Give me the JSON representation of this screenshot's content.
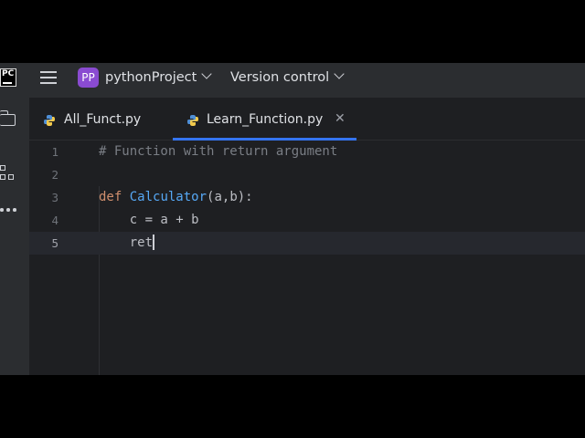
{
  "titlebar": {
    "app_logo": "PC",
    "project_badge": "PP",
    "project_name": "pythonProject",
    "version_control": "Version control"
  },
  "tabs": [
    {
      "label": "All_Funct.py",
      "active": false
    },
    {
      "label": "Learn_Function.py",
      "active": true,
      "close": "✕"
    }
  ],
  "editor": {
    "current_line": 5,
    "lines": [
      {
        "num": "1",
        "comment": "# Function with return argument"
      },
      {
        "num": "2"
      },
      {
        "num": "3",
        "kw": "def",
        "fn": "Calculator",
        "rest": "(a,b):"
      },
      {
        "num": "4",
        "code": "    c = a + b"
      },
      {
        "num": "5",
        "code": "    ret"
      }
    ]
  },
  "colors": {
    "accent": "#3574f0",
    "project_badge": "#8a4bd1",
    "keyword": "#cf8e6d",
    "function": "#56a8f5",
    "comment": "#7a7e85"
  },
  "icons": [
    "pycharm-logo-icon",
    "hamburger-menu-icon",
    "folder-icon",
    "structure-icon",
    "more-icon",
    "python-file-icon",
    "close-icon",
    "chevron-down-icon"
  ]
}
